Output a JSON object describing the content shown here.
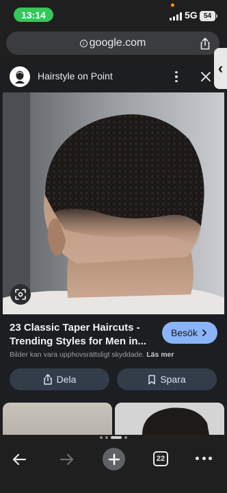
{
  "status_bar": {
    "time": "13:14",
    "network": "5G",
    "battery": "54"
  },
  "browser": {
    "url": "google.com"
  },
  "card": {
    "site_title": "Hairstyle on Point",
    "caption": "23 Classic Taper Haircuts - Trending Styles for Men in...",
    "visit_label": "Besök",
    "rights_notice": "Bilder kan vara upphovsrättsligt skyddade.",
    "learn_more": "Läs mer",
    "share_label": "Dela",
    "save_label": "Spara"
  },
  "toolbar": {
    "tab_count": "22"
  },
  "icons": [
    "info-icon",
    "share-icon",
    "side-panel-chevron-icon",
    "kebab-menu-icon",
    "close-icon",
    "google-lens-icon",
    "chevron-right-icon",
    "bookmark-icon",
    "back-arrow-icon",
    "forward-arrow-icon",
    "plus-icon",
    "tabs-icon",
    "more-icon"
  ],
  "colors": {
    "accent": "#8ab4f8",
    "time_pill": "#34c759",
    "background": "#1f1f1f"
  }
}
